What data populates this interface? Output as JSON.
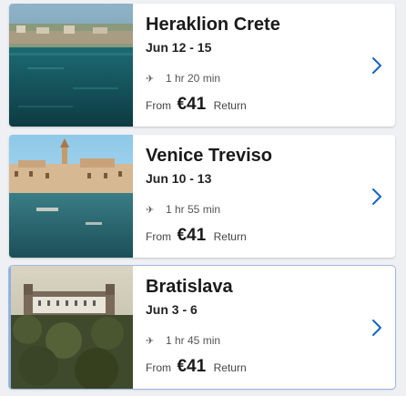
{
  "destinations": [
    {
      "city": "Heraklion Crete",
      "dates": "Jun 12 - 15",
      "duration": "1 hr 20 min",
      "from_label": "From",
      "price": "€41",
      "return_label": "Return",
      "image_icon": "harbor-photo"
    },
    {
      "city": "Venice Treviso",
      "dates": "Jun 10 - 13",
      "duration": "1 hr 55 min",
      "from_label": "From",
      "price": "€41",
      "return_label": "Return",
      "image_icon": "canal-photo"
    },
    {
      "city": "Bratislava",
      "dates": "Jun 3 - 6",
      "duration": "1 hr 45 min",
      "from_label": "From",
      "price": "€41",
      "return_label": "Return",
      "image_icon": "castle-photo"
    }
  ],
  "icons": {
    "flight": "plane-icon",
    "open": "chevron-right-icon"
  },
  "colors": {
    "chevron": "#1565c0",
    "card_bg": "#ffffff",
    "page_bg": "#eef0f3"
  }
}
